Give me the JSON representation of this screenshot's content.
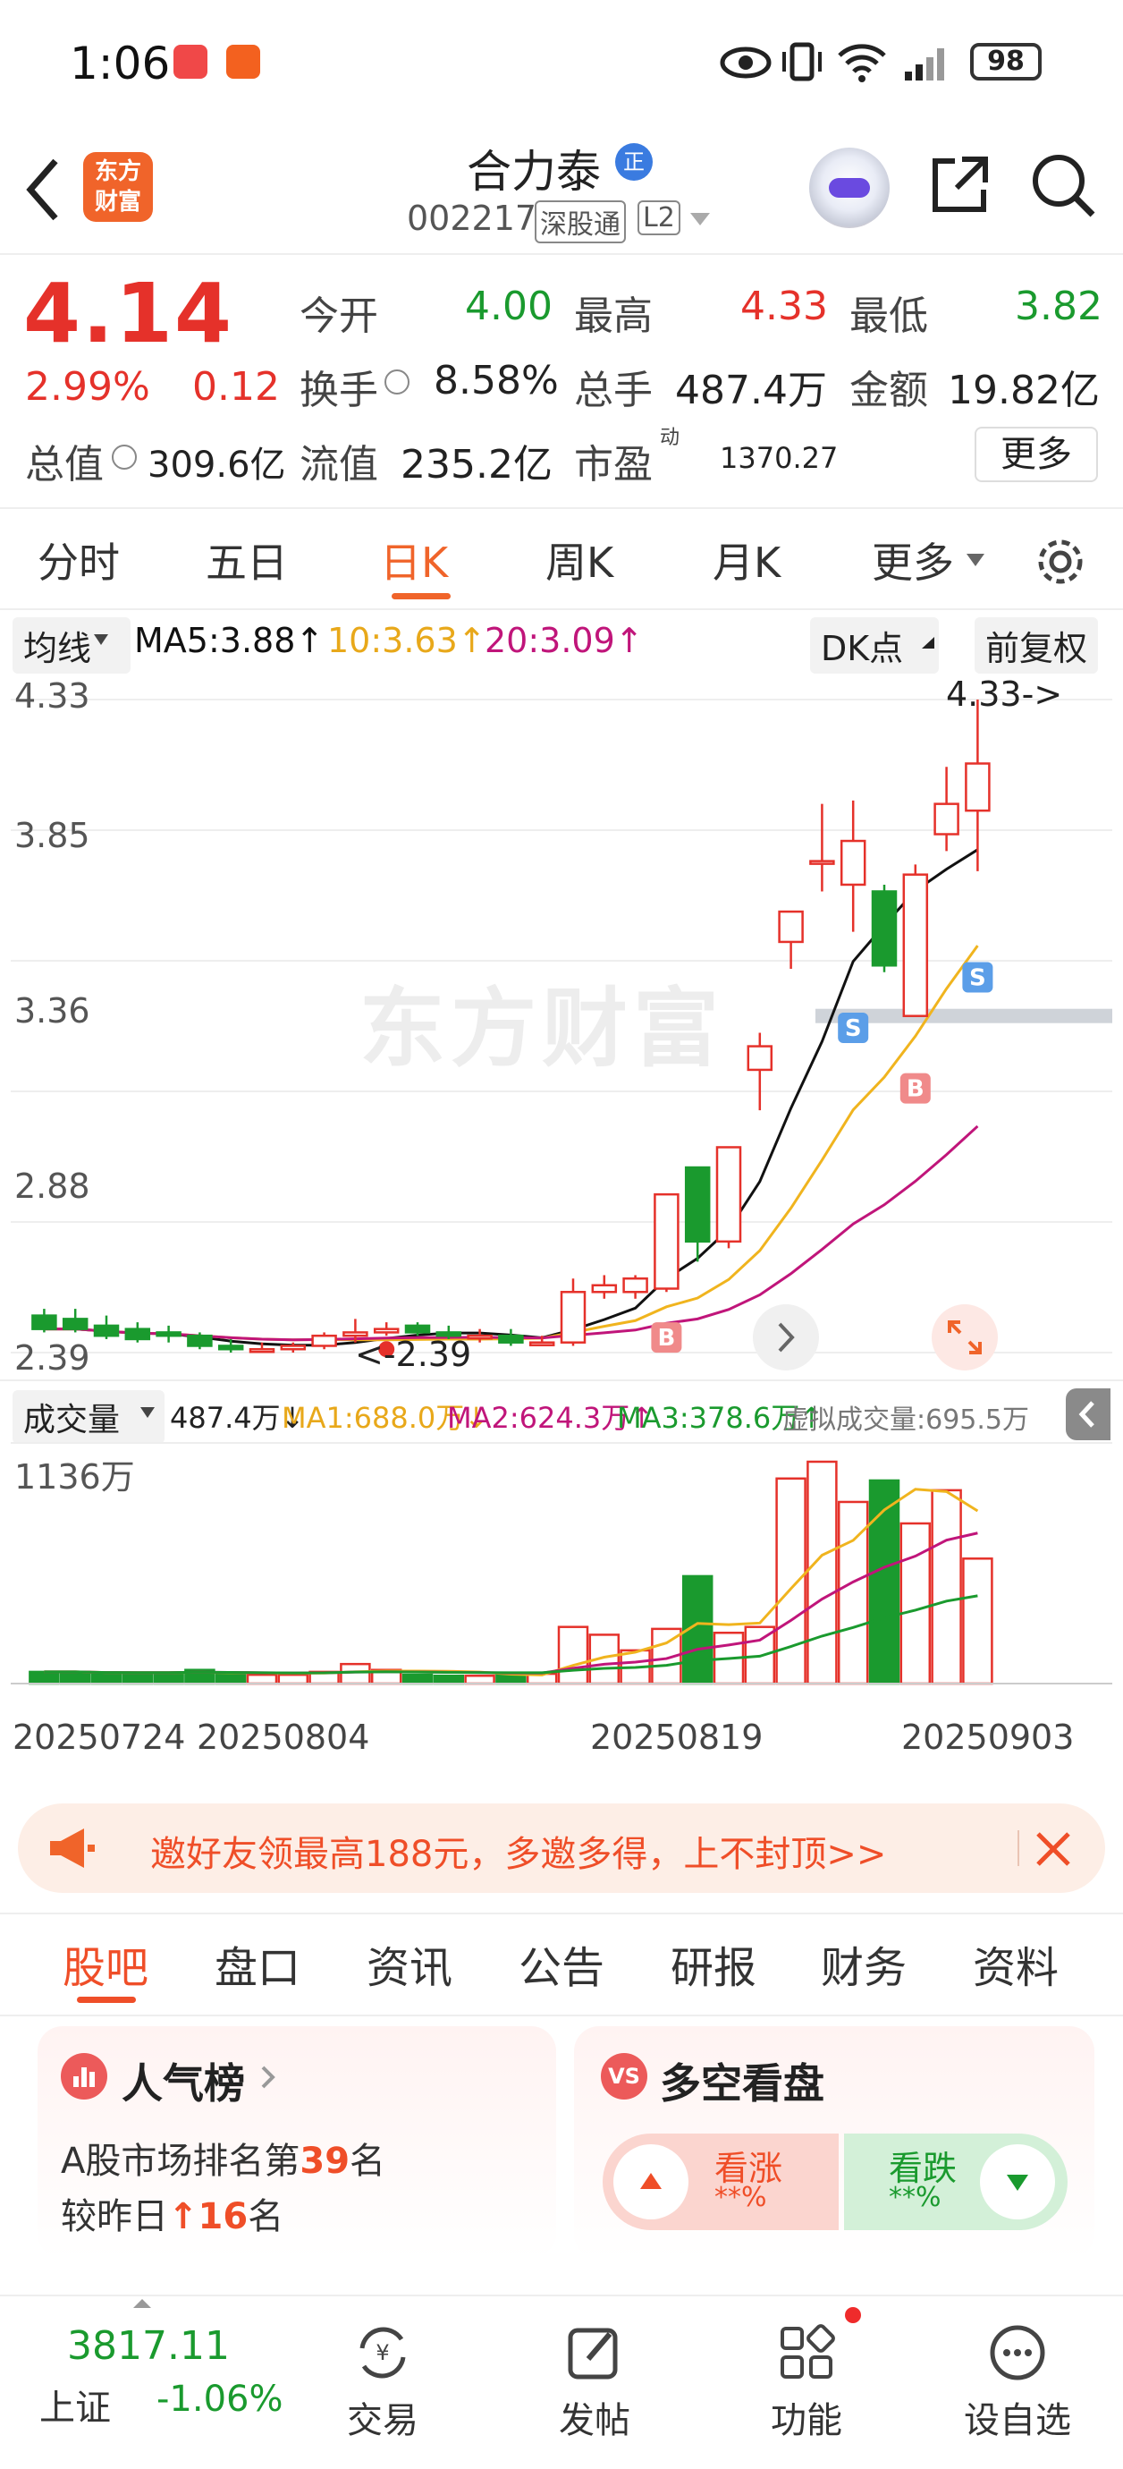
{
  "status_bar": {
    "time": "1:06",
    "battery": "98"
  },
  "header": {
    "logo_line1": "东方",
    "logo_line2": "财富",
    "stock_name": "合力泰",
    "badge": "正",
    "code": "002217",
    "exchange_tag": "深股通",
    "level_tag": "L2"
  },
  "quote": {
    "price": "4.14",
    "change_pct": "2.99%",
    "change_abs": "0.12",
    "open_label": "今开",
    "open": "4.00",
    "high_label": "最高",
    "high": "4.33",
    "low_label": "最低",
    "low": "3.82",
    "turnover_label": "换手",
    "turnover": "8.58%",
    "volume_label": "总手",
    "volume": "487.4万",
    "amount_label": "金额",
    "amount": "19.82亿",
    "mktcap_label": "总值",
    "mktcap": "309.6亿",
    "float_label": "流值",
    "float_cap": "235.2亿",
    "pe_label": "市盈",
    "pe_sup": "动",
    "pe": "1370.27",
    "more_label": "更多"
  },
  "period_tabs": [
    "分时",
    "五日",
    "日K",
    "周K",
    "月K",
    "更多"
  ],
  "active_tab": "日K",
  "ma_bar": {
    "select": "均线",
    "ma5": "MA5:3.88↑",
    "ma10": "10:3.63↑",
    "ma20": "20:3.09↑",
    "dk_label": "DK点",
    "adjust_label": "前复权"
  },
  "kline": {
    "y_ticks": [
      "4.33",
      "3.85",
      "3.36",
      "2.88",
      "2.39"
    ],
    "high_marker": "4.33->",
    "low_marker": "<-2.39",
    "watermark": "东方财富",
    "markers": {
      "b": "B",
      "s": "S"
    }
  },
  "volume_bar": {
    "select": "成交量",
    "vol": "487.4万↓",
    "ma1": "MA1:688.0万↓",
    "ma2": "MA2:624.3万↑",
    "ma3": "MA3:378.6万↑",
    "virtual": "虚拟成交量:695.5万",
    "y_max": "1136万"
  },
  "dates": [
    "20250724",
    "20250804",
    "20250819",
    "20250903"
  ],
  "banner": {
    "text": "邀好友领最高188元，多邀多得，上不封顶>>"
  },
  "sub_tabs": [
    "股吧",
    "盘口",
    "资讯",
    "公告",
    "研报",
    "财务",
    "资料"
  ],
  "popularity_card": {
    "title": "人气榜",
    "rank_prefix": "A股市场排名第",
    "rank": "39",
    "rank_suffix": "名",
    "change_prefix": "较昨日",
    "change": "16",
    "change_suffix": "名"
  },
  "bull_bear_card": {
    "title": "多空看盘",
    "bull": "看涨",
    "bull_pct": "**%",
    "bear": "看跌",
    "bear_pct": "**%"
  },
  "bottom_nav": {
    "index_value": "3817.11",
    "index_name": "上证",
    "index_change": "-1.06%",
    "trade": "交易",
    "post": "发帖",
    "functions": "功能",
    "watchlist": "设自选"
  },
  "colors": {
    "up": "#e5312a",
    "down": "#1a9a2e",
    "ma5": "#111111",
    "ma10": "#f0b41e",
    "ma20": "#c0157a",
    "accent": "#f0642a"
  },
  "chart_data": {
    "type": "candlestick",
    "ylim": [
      2.39,
      4.33
    ],
    "candles": [
      {
        "o": 2.5,
        "c": 2.46,
        "h": 2.52,
        "l": 2.45
      },
      {
        "o": 2.49,
        "c": 2.46,
        "h": 2.52,
        "l": 2.45
      },
      {
        "o": 2.47,
        "c": 2.44,
        "h": 2.5,
        "l": 2.43
      },
      {
        "o": 2.46,
        "c": 2.43,
        "h": 2.48,
        "l": 2.42
      },
      {
        "o": 2.45,
        "c": 2.44,
        "h": 2.47,
        "l": 2.42
      },
      {
        "o": 2.44,
        "c": 2.41,
        "h": 2.45,
        "l": 2.4
      },
      {
        "o": 2.41,
        "c": 2.4,
        "h": 2.43,
        "l": 2.39
      },
      {
        "o": 2.4,
        "c": 2.4,
        "h": 2.42,
        "l": 2.39
      },
      {
        "o": 2.4,
        "c": 2.41,
        "h": 2.42,
        "l": 2.39
      },
      {
        "o": 2.41,
        "c": 2.44,
        "h": 2.45,
        "l": 2.4
      },
      {
        "o": 2.44,
        "c": 2.45,
        "h": 2.49,
        "l": 2.42
      },
      {
        "o": 2.45,
        "c": 2.46,
        "h": 2.48,
        "l": 2.44
      },
      {
        "o": 2.47,
        "c": 2.45,
        "h": 2.48,
        "l": 2.44
      },
      {
        "o": 2.45,
        "c": 2.44,
        "h": 2.47,
        "l": 2.43
      },
      {
        "o": 2.44,
        "c": 2.44,
        "h": 2.46,
        "l": 2.42
      },
      {
        "o": 2.44,
        "c": 2.42,
        "h": 2.46,
        "l": 2.41
      },
      {
        "o": 2.42,
        "c": 2.42,
        "h": 2.44,
        "l": 2.41
      },
      {
        "o": 2.42,
        "c": 2.57,
        "h": 2.61,
        "l": 2.41
      },
      {
        "o": 2.57,
        "c": 2.59,
        "h": 2.62,
        "l": 2.55
      },
      {
        "o": 2.57,
        "c": 2.61,
        "h": 2.62,
        "l": 2.55
      },
      {
        "o": 2.58,
        "c": 2.86,
        "h": 2.86,
        "l": 2.57
      },
      {
        "o": 2.94,
        "c": 2.72,
        "h": 2.94,
        "l": 2.66
      },
      {
        "o": 2.72,
        "c": 3.0,
        "h": 3.0,
        "l": 2.7
      },
      {
        "o": 3.23,
        "c": 3.3,
        "h": 3.34,
        "l": 3.11
      },
      {
        "o": 3.61,
        "c": 3.7,
        "h": 3.7,
        "l": 3.53
      },
      {
        "o": 3.85,
        "c": 3.85,
        "h": 4.02,
        "l": 3.76
      },
      {
        "o": 3.78,
        "c": 3.91,
        "h": 4.03,
        "l": 3.64
      },
      {
        "o": 3.76,
        "c": 3.54,
        "h": 3.78,
        "l": 3.52
      },
      {
        "o": 3.39,
        "c": 3.81,
        "h": 3.84,
        "l": 3.39
      },
      {
        "o": 3.93,
        "c": 4.02,
        "h": 4.13,
        "l": 3.88
      },
      {
        "o": 4.0,
        "c": 4.14,
        "h": 4.33,
        "l": 3.82
      }
    ],
    "volumes": [
      60,
      60,
      50,
      55,
      55,
      70,
      50,
      45,
      45,
      60,
      100,
      70,
      45,
      40,
      40,
      45,
      50,
      290,
      250,
      170,
      280,
      550,
      260,
      290,
      1050,
      1136,
      930,
      1040,
      820,
      990,
      640
    ]
  }
}
